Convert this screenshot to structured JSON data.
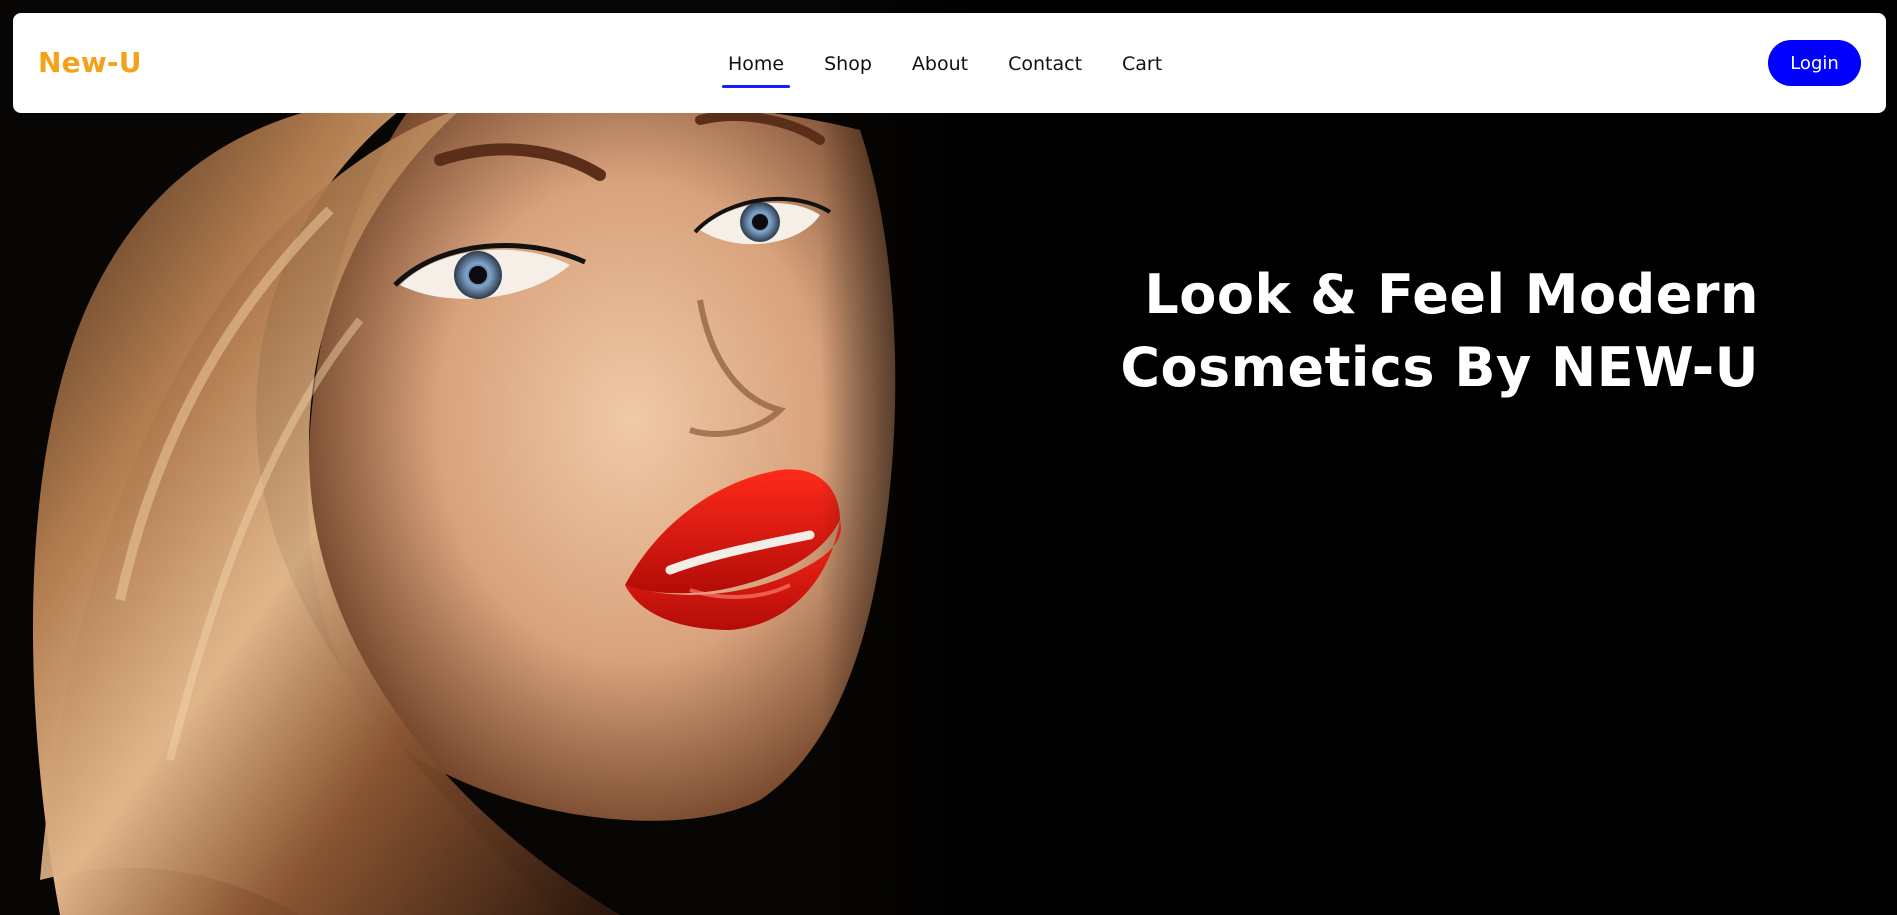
{
  "nav": {
    "brand": "New-U",
    "links": [
      {
        "label": "Home",
        "active": true
      },
      {
        "label": "Shop",
        "active": false
      },
      {
        "label": "About",
        "active": false
      },
      {
        "label": "Contact",
        "active": false
      },
      {
        "label": "Cart",
        "active": false
      }
    ],
    "login_label": "Login"
  },
  "hero": {
    "headline_line1": "Look & Feel Modern",
    "headline_line2": "Cosmetics By NEW-U",
    "image_subject": "portrait of woman with long brown hair and red lipstick"
  },
  "colors": {
    "brand": "#f5a21b",
    "accent": "#0000ff",
    "background": "#000000",
    "navbar": "#ffffff"
  }
}
